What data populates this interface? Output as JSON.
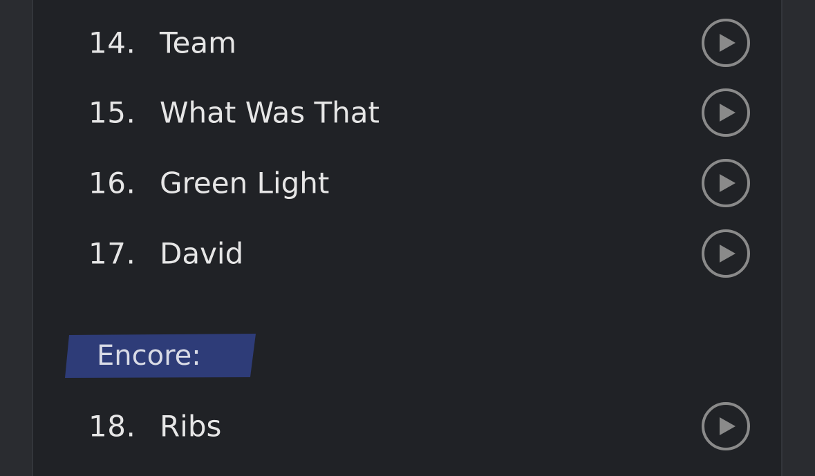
{
  "setlist": {
    "tracks": [
      {
        "number": "14.",
        "title": "Team"
      },
      {
        "number": "15.",
        "title": "What Was That"
      },
      {
        "number": "16.",
        "title": "Green Light"
      },
      {
        "number": "17.",
        "title": "David"
      }
    ],
    "encore_label": "Encore:",
    "encore_tracks": [
      {
        "number": "18.",
        "title": "Ribs"
      }
    ]
  },
  "icons": {
    "play": "play-icon"
  },
  "colors": {
    "background": "#2a2c30",
    "panel": "#202226",
    "text": "#e6e6e6",
    "play_icon": "#8a8a8a",
    "encore_highlight": "#2e3c78"
  }
}
